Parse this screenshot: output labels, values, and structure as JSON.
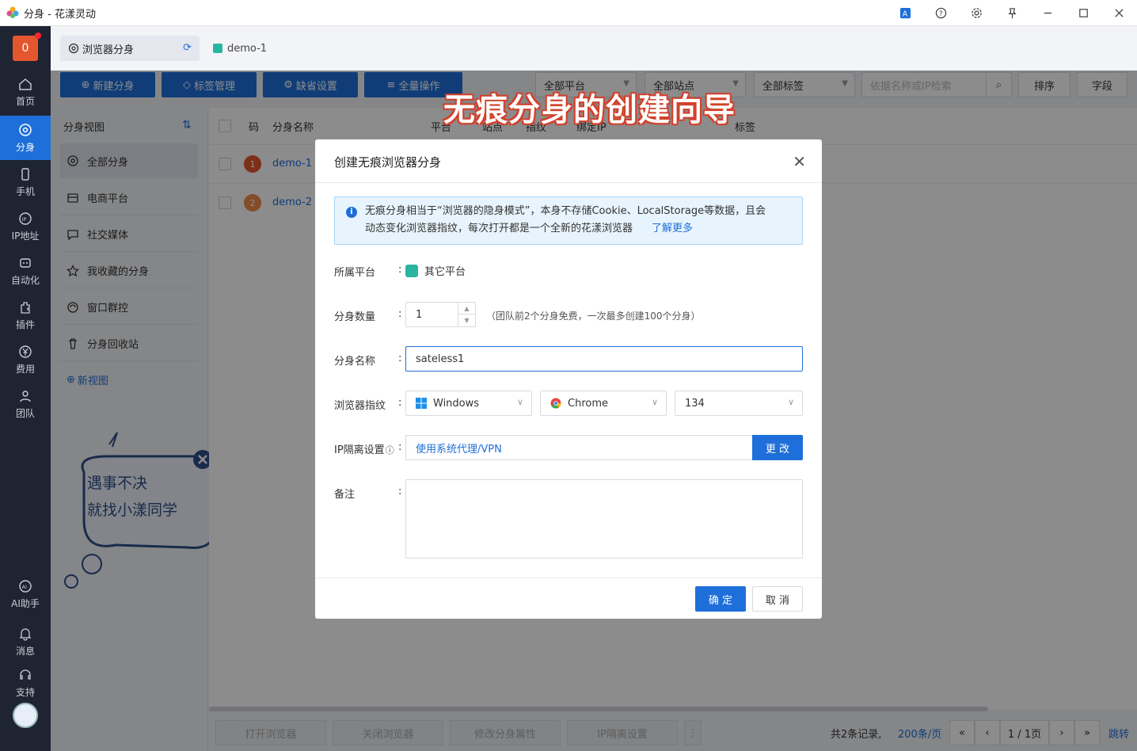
{
  "window": {
    "title": "分身 - 花漾灵动",
    "controls": [
      "translate-icon",
      "help-icon",
      "settings-icon",
      "pin-icon",
      "minimize-icon",
      "maximize-icon",
      "close-icon"
    ]
  },
  "rail": {
    "badge": "0",
    "items": [
      {
        "label": "首页",
        "icon": "home-icon"
      },
      {
        "label": "分身",
        "icon": "browser-icon",
        "active": true
      },
      {
        "label": "手机",
        "icon": "phone-icon"
      },
      {
        "label": "IP地址",
        "icon": "ip-icon"
      },
      {
        "label": "自动化",
        "icon": "robot-icon"
      },
      {
        "label": "插件",
        "icon": "plugin-icon"
      },
      {
        "label": "费用",
        "icon": "yen-icon"
      },
      {
        "label": "团队",
        "icon": "team-icon"
      },
      {
        "label": "AI助手",
        "icon": "ai-icon"
      },
      {
        "label": "消息",
        "icon": "bell-icon"
      },
      {
        "label": "支持",
        "icon": "headset-icon"
      }
    ]
  },
  "tabs": [
    {
      "label": "浏览器分身"
    },
    {
      "label": "demo-1"
    }
  ],
  "toolbar": {
    "new_label": "新建分身",
    "tags_label": "标签管理",
    "default_label": "缺省设置",
    "batch_label": "全量操作",
    "platform_filter": "全部平台",
    "site_filter": "全部站点",
    "tag_filter": "全部标签",
    "search_placeholder": "依据名称或IP检索",
    "sort_label": "排序",
    "fields_label": "字段"
  },
  "views": {
    "header": "分身视图",
    "items": [
      {
        "label": "全部分身",
        "active": true
      },
      {
        "label": "电商平台"
      },
      {
        "label": "社交媒体"
      },
      {
        "label": "我收藏的分身"
      },
      {
        "label": "窗口群控"
      },
      {
        "label": "分身回收站"
      }
    ],
    "new_view": "新视图",
    "mascot_line1": "遇事不决",
    "mascot_line2": "就找小漾同学"
  },
  "table": {
    "headers": [
      "码",
      "分身名称",
      "平台",
      "站点",
      "指纹",
      "绑定IP",
      "标签"
    ],
    "rows": [
      {
        "num": "1",
        "name": "demo-1",
        "color": "#e4572e"
      },
      {
        "num": "2",
        "name": "demo-2",
        "color": "#e4572e"
      }
    ]
  },
  "bottom": {
    "open_browser": "打开浏览器",
    "close_browser": "关闭浏览器",
    "edit_props": "修改分身属性",
    "ip_setting": "IP隔离设置",
    "total": "共2条记录,",
    "page_size": "200条/页",
    "page": "1 / 1页",
    "jump": "跳转"
  },
  "banner": "无痕分身的创建向导",
  "modal": {
    "title": "创建无痕浏览器分身",
    "info_text": "无痕分身相当于“浏览器的隐身模式”，本身不存储Cookie、LocalStorage等数据，且会动态变化浏览器指纹，每次打开都是一个全新的花漾浏览器",
    "info_line1": "无痕分身相当于“浏览器的隐身模式”，本身不存储Cookie、LocalStorage等数据，且会",
    "info_line2": "动态变化浏览器指纹，每次打开都是一个全新的花漾浏览器",
    "learn_more": "了解更多",
    "platform_label": "所属平台",
    "platform_value": "其它平台",
    "count_label": "分身数量",
    "count_value": "1",
    "count_hint": "（团队前2个分身免费，一次最多创建100个分身）",
    "name_label": "分身名称",
    "name_value": "sateless1",
    "fingerprint_label": "浏览器指纹",
    "os_value": "Windows",
    "browser_value": "Chrome",
    "version_value": "134",
    "ip_label": "IP隔离设置",
    "ip_value": "使用系统代理/VPN",
    "change_label": "更 改",
    "remark_label": "备注",
    "remark_value": "",
    "ok_label": "确 定",
    "cancel_label": "取 消",
    "colon": ":"
  }
}
